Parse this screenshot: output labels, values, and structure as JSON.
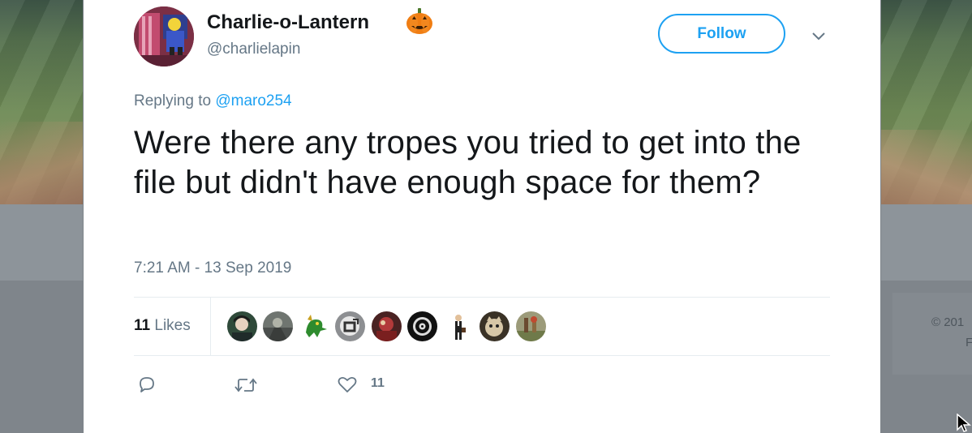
{
  "tweet": {
    "author": {
      "name": "Charlie-o-Lantern",
      "name_emoji_icon": "jack-o-lantern-icon",
      "handle": "@charlielapin"
    },
    "follow_label": "Follow",
    "replying_prefix": "Replying to",
    "replying_to": "@maro254",
    "text": "Were there any tropes you tried to get into the file but didn't have enough space for them?",
    "timestamp": "7:21 AM - 13 Sep 2019",
    "likes": {
      "count": "11",
      "label": "Likes",
      "liker_avatars": 9
    },
    "actions": {
      "reply_icon": "reply-bubble-icon",
      "retweet_icon": "retweet-icon",
      "like_icon": "heart-icon",
      "like_count": "11"
    }
  },
  "background": {
    "copyright_fragment": "© 201",
    "extra_fragment": "F"
  },
  "colors": {
    "accent": "#1da1f2",
    "secondary_text": "#657786",
    "primary_text": "#14171a"
  }
}
